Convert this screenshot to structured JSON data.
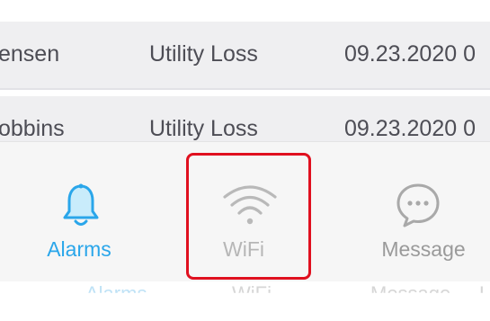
{
  "table": {
    "rows": [
      {
        "name": "ensen",
        "type": "Utility Loss",
        "date": "09.23.2020 0"
      },
      {
        "name": "obbins",
        "type": "Utility Loss",
        "date": "09.23.2020 0"
      }
    ]
  },
  "tabbar": {
    "tabs": [
      {
        "label": "Alarms",
        "icon": "bell-icon",
        "color": "#2aa6ea"
      },
      {
        "label": "WiFi",
        "icon": "wifi-icon",
        "color": "#b6b6b6"
      },
      {
        "label": "Message",
        "icon": "chat-bubble-icon",
        "color": "#9a9a9a"
      }
    ],
    "highlight_color": "#e0101f"
  },
  "ghost_tabbar": {
    "labels": [
      "Alarms",
      "WiFi",
      "Message",
      "L"
    ]
  }
}
